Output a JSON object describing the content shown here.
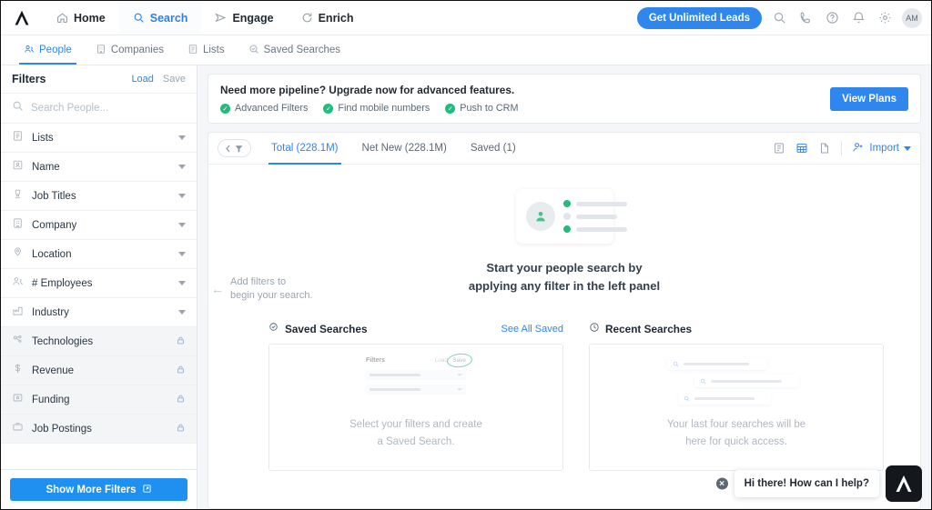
{
  "topnav": {
    "logo": "apollo-logo",
    "items": [
      {
        "label": "Home",
        "icon": "home-icon",
        "active": false
      },
      {
        "label": "Search",
        "icon": "search-icon",
        "active": true
      },
      {
        "label": "Engage",
        "icon": "send-icon",
        "active": false
      },
      {
        "label": "Enrich",
        "icon": "refresh-icon",
        "active": false
      }
    ],
    "cta_label": "Get Unlimited Leads",
    "icons": [
      "search-icon",
      "phone-icon",
      "help-icon",
      "bell-icon",
      "gear-icon"
    ],
    "avatar_initials": "AM"
  },
  "subnav": {
    "items": [
      {
        "label": "People",
        "icon": "people-icon",
        "active": true
      },
      {
        "label": "Companies",
        "icon": "company-icon",
        "active": false
      },
      {
        "label": "Lists",
        "icon": "list-icon",
        "active": false
      },
      {
        "label": "Saved Searches",
        "icon": "saved-search-icon",
        "active": false
      }
    ]
  },
  "sidebar": {
    "title": "Filters",
    "load_label": "Load",
    "save_label": "Save",
    "search_placeholder": "Search People...",
    "filters": [
      {
        "label": "Lists",
        "icon": "list-icon",
        "locked": false
      },
      {
        "label": "Name",
        "icon": "name-icon",
        "locked": false
      },
      {
        "label": "Job Titles",
        "icon": "job-title-icon",
        "locked": false
      },
      {
        "label": "Company",
        "icon": "company-icon",
        "locked": false
      },
      {
        "label": "Location",
        "icon": "location-icon",
        "locked": false
      },
      {
        "label": "# Employees",
        "icon": "employees-icon",
        "locked": false
      },
      {
        "label": "Industry",
        "icon": "industry-icon",
        "locked": false
      },
      {
        "label": "Technologies",
        "icon": "technologies-icon",
        "locked": true
      },
      {
        "label": "Revenue",
        "icon": "revenue-icon",
        "locked": true
      },
      {
        "label": "Funding",
        "icon": "funding-icon",
        "locked": true
      },
      {
        "label": "Job Postings",
        "icon": "job-postings-icon",
        "locked": true
      }
    ],
    "show_more_label": "Show More Filters"
  },
  "banner": {
    "headline": "Need more pipeline? Upgrade now for advanced features.",
    "features": [
      "Advanced Filters",
      "Find mobile numbers",
      "Push to CRM"
    ],
    "button_label": "View Plans"
  },
  "panel": {
    "tabs": [
      {
        "label": "Total (228.1M)",
        "active": true
      },
      {
        "label": "Net New (228.1M)",
        "active": false
      },
      {
        "label": "Saved (1)",
        "active": false
      }
    ],
    "view_icons": [
      "list-view-icon",
      "table-view-icon",
      "export-view-icon"
    ],
    "import_label": "Import"
  },
  "empty_state": {
    "hint_line1": "Add filters to",
    "hint_line2": "begin your search.",
    "title_line1": "Start your people search by",
    "title_line2": "applying any filter in the left panel"
  },
  "saved_searches": {
    "title": "Saved Searches",
    "see_all_label": "See All Saved",
    "caption_line1": "Select your filters and create",
    "caption_line2": "a Saved Search.",
    "mini": {
      "filters_label": "Filters",
      "load_label": "Load",
      "save_label": "Save"
    }
  },
  "recent_searches": {
    "title": "Recent Searches",
    "caption_line1": "Your last four searches will be",
    "caption_line2": "here for quick access."
  },
  "chat": {
    "message": "Hi there! How can I help?",
    "close_icon": "close-icon",
    "button_icon": "apollo-logo"
  },
  "colors": {
    "accent_blue": "#2f86ec",
    "green": "#22bb7e",
    "canvas": "#f4f6fa",
    "locked_row": "#f3f5f7"
  }
}
